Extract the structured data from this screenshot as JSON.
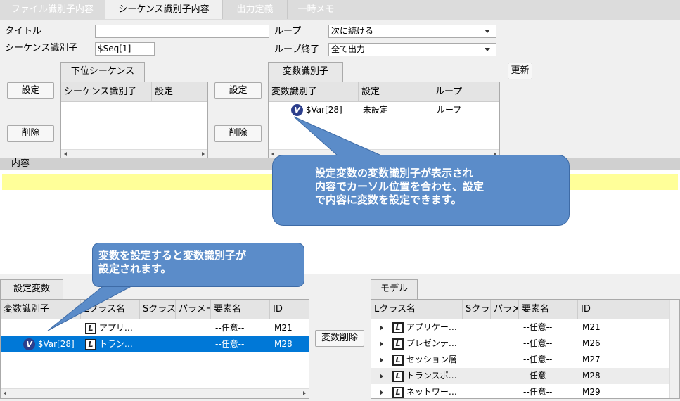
{
  "tabs": [
    "ファイル識別子内容",
    "シーケンス識別子内容",
    "出力定義",
    "一時メモ"
  ],
  "form": {
    "title_label": "タイトル",
    "title_value": "",
    "seqid_label": "シーケンス識別子",
    "seqid_value": "$Seq[1]",
    "loop_label": "ループ",
    "loop_value": "次に続ける",
    "loop_end_label": "ループ終了",
    "loop_end_value": "全て出力",
    "refresh_btn": "更新"
  },
  "sub_seq": {
    "tab": "下位シーケンス",
    "set_btn": "設定",
    "del_btn": "削除",
    "col1": "シーケンス識別子",
    "col2": "設定"
  },
  "var_id": {
    "tab": "変数識別子",
    "set_btn": "設定",
    "del_btn": "削除",
    "col1": "変数識別子",
    "col2": "設定",
    "col3": "ループ",
    "row_var": "$Var[28]",
    "row_set": "未設定",
    "row_loop": "ループ",
    "v": "V"
  },
  "content_label": "内容",
  "callout1": {
    "l1": "設定変数の変数識別子が表示され",
    "l2": "内容でカーソル位置を合わせ、設定",
    "l3": "で内容に変数を設定できます。"
  },
  "callout2": {
    "l1": "変数を設定すると変数識別子が",
    "l2": "設定されます。"
  },
  "setvar": {
    "tab": "設定変数",
    "cols": [
      "変数識別子",
      "Lクラス名",
      "Sクラス",
      "パラメー",
      "要素名",
      "ID"
    ],
    "rows": [
      {
        "var": "",
        "lname": "アプリ…",
        "elem": "--任意--",
        "id": "M21"
      },
      {
        "var": "$Var[28]",
        "lname": "トラン…",
        "elem": "--任意--",
        "id": "M28"
      }
    ]
  },
  "var_del_btn": "変数削除",
  "model": {
    "tab": "モデル",
    "cols": [
      "Lクラス名",
      "Sクラス",
      "パラメ",
      "要素名",
      "ID"
    ],
    "rows": [
      {
        "lname": "アプリケー…",
        "elem": "--任意--",
        "id": "M21"
      },
      {
        "lname": "プレゼンテ…",
        "elem": "--任意--",
        "id": "M26"
      },
      {
        "lname": "セッション層",
        "elem": "--任意--",
        "id": "M27"
      },
      {
        "lname": "トランスポ…",
        "elem": "--任意--",
        "id": "M28"
      },
      {
        "lname": "ネットワー…",
        "elem": "--任意--",
        "id": "M29"
      }
    ]
  },
  "icons": {
    "L": "L",
    "V": "V"
  }
}
